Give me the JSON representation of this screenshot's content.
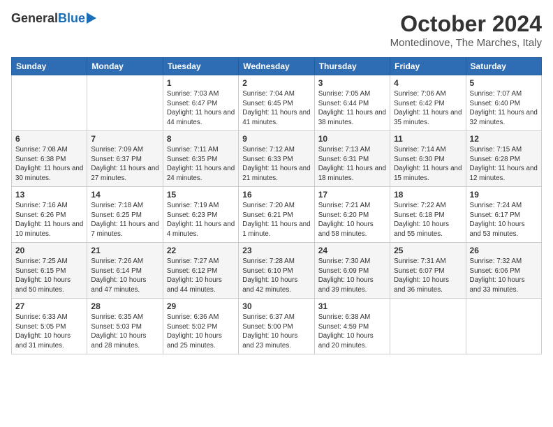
{
  "header": {
    "logo": {
      "general": "General",
      "blue": "Blue"
    },
    "title": "October 2024",
    "location": "Montedinove, The Marches, Italy"
  },
  "days_of_week": [
    "Sunday",
    "Monday",
    "Tuesday",
    "Wednesday",
    "Thursday",
    "Friday",
    "Saturday"
  ],
  "weeks": [
    [
      {
        "day": "",
        "info": ""
      },
      {
        "day": "",
        "info": ""
      },
      {
        "day": "1",
        "info": "Sunrise: 7:03 AM\nSunset: 6:47 PM\nDaylight: 11 hours and 44 minutes."
      },
      {
        "day": "2",
        "info": "Sunrise: 7:04 AM\nSunset: 6:45 PM\nDaylight: 11 hours and 41 minutes."
      },
      {
        "day": "3",
        "info": "Sunrise: 7:05 AM\nSunset: 6:44 PM\nDaylight: 11 hours and 38 minutes."
      },
      {
        "day": "4",
        "info": "Sunrise: 7:06 AM\nSunset: 6:42 PM\nDaylight: 11 hours and 35 minutes."
      },
      {
        "day": "5",
        "info": "Sunrise: 7:07 AM\nSunset: 6:40 PM\nDaylight: 11 hours and 32 minutes."
      }
    ],
    [
      {
        "day": "6",
        "info": "Sunrise: 7:08 AM\nSunset: 6:38 PM\nDaylight: 11 hours and 30 minutes."
      },
      {
        "day": "7",
        "info": "Sunrise: 7:09 AM\nSunset: 6:37 PM\nDaylight: 11 hours and 27 minutes."
      },
      {
        "day": "8",
        "info": "Sunrise: 7:11 AM\nSunset: 6:35 PM\nDaylight: 11 hours and 24 minutes."
      },
      {
        "day": "9",
        "info": "Sunrise: 7:12 AM\nSunset: 6:33 PM\nDaylight: 11 hours and 21 minutes."
      },
      {
        "day": "10",
        "info": "Sunrise: 7:13 AM\nSunset: 6:31 PM\nDaylight: 11 hours and 18 minutes."
      },
      {
        "day": "11",
        "info": "Sunrise: 7:14 AM\nSunset: 6:30 PM\nDaylight: 11 hours and 15 minutes."
      },
      {
        "day": "12",
        "info": "Sunrise: 7:15 AM\nSunset: 6:28 PM\nDaylight: 11 hours and 12 minutes."
      }
    ],
    [
      {
        "day": "13",
        "info": "Sunrise: 7:16 AM\nSunset: 6:26 PM\nDaylight: 11 hours and 10 minutes."
      },
      {
        "day": "14",
        "info": "Sunrise: 7:18 AM\nSunset: 6:25 PM\nDaylight: 11 hours and 7 minutes."
      },
      {
        "day": "15",
        "info": "Sunrise: 7:19 AM\nSunset: 6:23 PM\nDaylight: 11 hours and 4 minutes."
      },
      {
        "day": "16",
        "info": "Sunrise: 7:20 AM\nSunset: 6:21 PM\nDaylight: 11 hours and 1 minute."
      },
      {
        "day": "17",
        "info": "Sunrise: 7:21 AM\nSunset: 6:20 PM\nDaylight: 10 hours and 58 minutes."
      },
      {
        "day": "18",
        "info": "Sunrise: 7:22 AM\nSunset: 6:18 PM\nDaylight: 10 hours and 55 minutes."
      },
      {
        "day": "19",
        "info": "Sunrise: 7:24 AM\nSunset: 6:17 PM\nDaylight: 10 hours and 53 minutes."
      }
    ],
    [
      {
        "day": "20",
        "info": "Sunrise: 7:25 AM\nSunset: 6:15 PM\nDaylight: 10 hours and 50 minutes."
      },
      {
        "day": "21",
        "info": "Sunrise: 7:26 AM\nSunset: 6:14 PM\nDaylight: 10 hours and 47 minutes."
      },
      {
        "day": "22",
        "info": "Sunrise: 7:27 AM\nSunset: 6:12 PM\nDaylight: 10 hours and 44 minutes."
      },
      {
        "day": "23",
        "info": "Sunrise: 7:28 AM\nSunset: 6:10 PM\nDaylight: 10 hours and 42 minutes."
      },
      {
        "day": "24",
        "info": "Sunrise: 7:30 AM\nSunset: 6:09 PM\nDaylight: 10 hours and 39 minutes."
      },
      {
        "day": "25",
        "info": "Sunrise: 7:31 AM\nSunset: 6:07 PM\nDaylight: 10 hours and 36 minutes."
      },
      {
        "day": "26",
        "info": "Sunrise: 7:32 AM\nSunset: 6:06 PM\nDaylight: 10 hours and 33 minutes."
      }
    ],
    [
      {
        "day": "27",
        "info": "Sunrise: 6:33 AM\nSunset: 5:05 PM\nDaylight: 10 hours and 31 minutes."
      },
      {
        "day": "28",
        "info": "Sunrise: 6:35 AM\nSunset: 5:03 PM\nDaylight: 10 hours and 28 minutes."
      },
      {
        "day": "29",
        "info": "Sunrise: 6:36 AM\nSunset: 5:02 PM\nDaylight: 10 hours and 25 minutes."
      },
      {
        "day": "30",
        "info": "Sunrise: 6:37 AM\nSunset: 5:00 PM\nDaylight: 10 hours and 23 minutes."
      },
      {
        "day": "31",
        "info": "Sunrise: 6:38 AM\nSunset: 4:59 PM\nDaylight: 10 hours and 20 minutes."
      },
      {
        "day": "",
        "info": ""
      },
      {
        "day": "",
        "info": ""
      }
    ]
  ]
}
